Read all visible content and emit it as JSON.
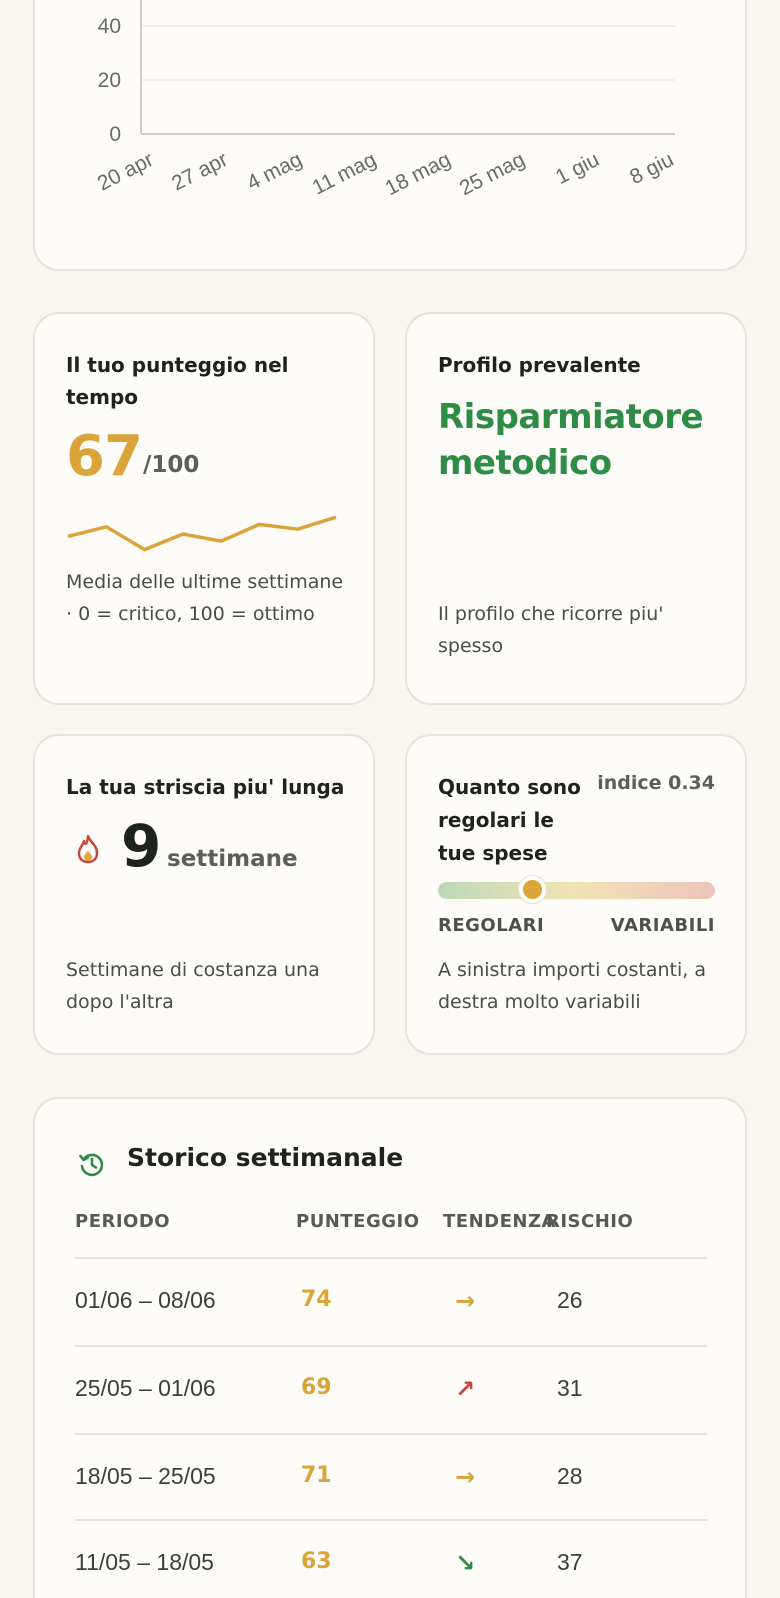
{
  "trend_chart": {
    "chart_data": {
      "type": "line",
      "y_ticks": [
        "0",
        "20",
        "40"
      ],
      "x_ticks": [
        "20 apr",
        "27 apr",
        "4 mag",
        "11 mag",
        "18 mag",
        "25 mag",
        "1 giu",
        "8 giu"
      ],
      "ylim": [
        0,
        100
      ],
      "grid": true
    }
  },
  "score_card": {
    "title": "Il tuo punteggio nel tempo",
    "value": "67",
    "max": "/100",
    "sparkline": [
      58,
      66,
      47,
      60,
      54,
      68,
      64,
      74
    ],
    "description": "Media delle ultime settimane · 0 = critico, 100 = ottimo",
    "color": "#dba43a"
  },
  "profile_card": {
    "title": "Profilo prevalente",
    "value": "Risparmiatore metodico",
    "description": "Il profilo che ricorre piu' spesso",
    "color": "#2f8c47"
  },
  "streak_card": {
    "title": "La tua striscia piu' lunga",
    "icon": "flame-icon",
    "value": "9",
    "unit": "settimane",
    "description": "Settimane di costanza una dopo l'altra"
  },
  "regularity_card": {
    "title": "Quanto sono regolari le tue spese",
    "index_label": "indice 0.34",
    "index_value": 0.34,
    "left_label": "REGOLARI",
    "right_label": "VARIABILI",
    "description": "A sinistra importi costanti, a destra molto variabili"
  },
  "history": {
    "title": "Storico settimanale",
    "icon": "history-icon",
    "headers": {
      "period": "PERIODO",
      "score": "PUNTEGGIO",
      "trend": "TENDENZA",
      "risk": "RISCHIO"
    },
    "rows": [
      {
        "period": "01/06 – 08/06",
        "score": "74",
        "trend": "→",
        "trend_color": "#dba43a",
        "risk": "26"
      },
      {
        "period": "25/05 – 01/06",
        "score": "69",
        "trend": "↗",
        "trend_color": "#c4473d",
        "risk": "31"
      },
      {
        "period": "18/05 – 25/05",
        "score": "71",
        "trend": "→",
        "trend_color": "#dba43a",
        "risk": "28"
      },
      {
        "period": "11/05 – 18/05",
        "score": "63",
        "trend": "↘",
        "trend_color": "#2f8c47",
        "risk": "37"
      }
    ]
  }
}
